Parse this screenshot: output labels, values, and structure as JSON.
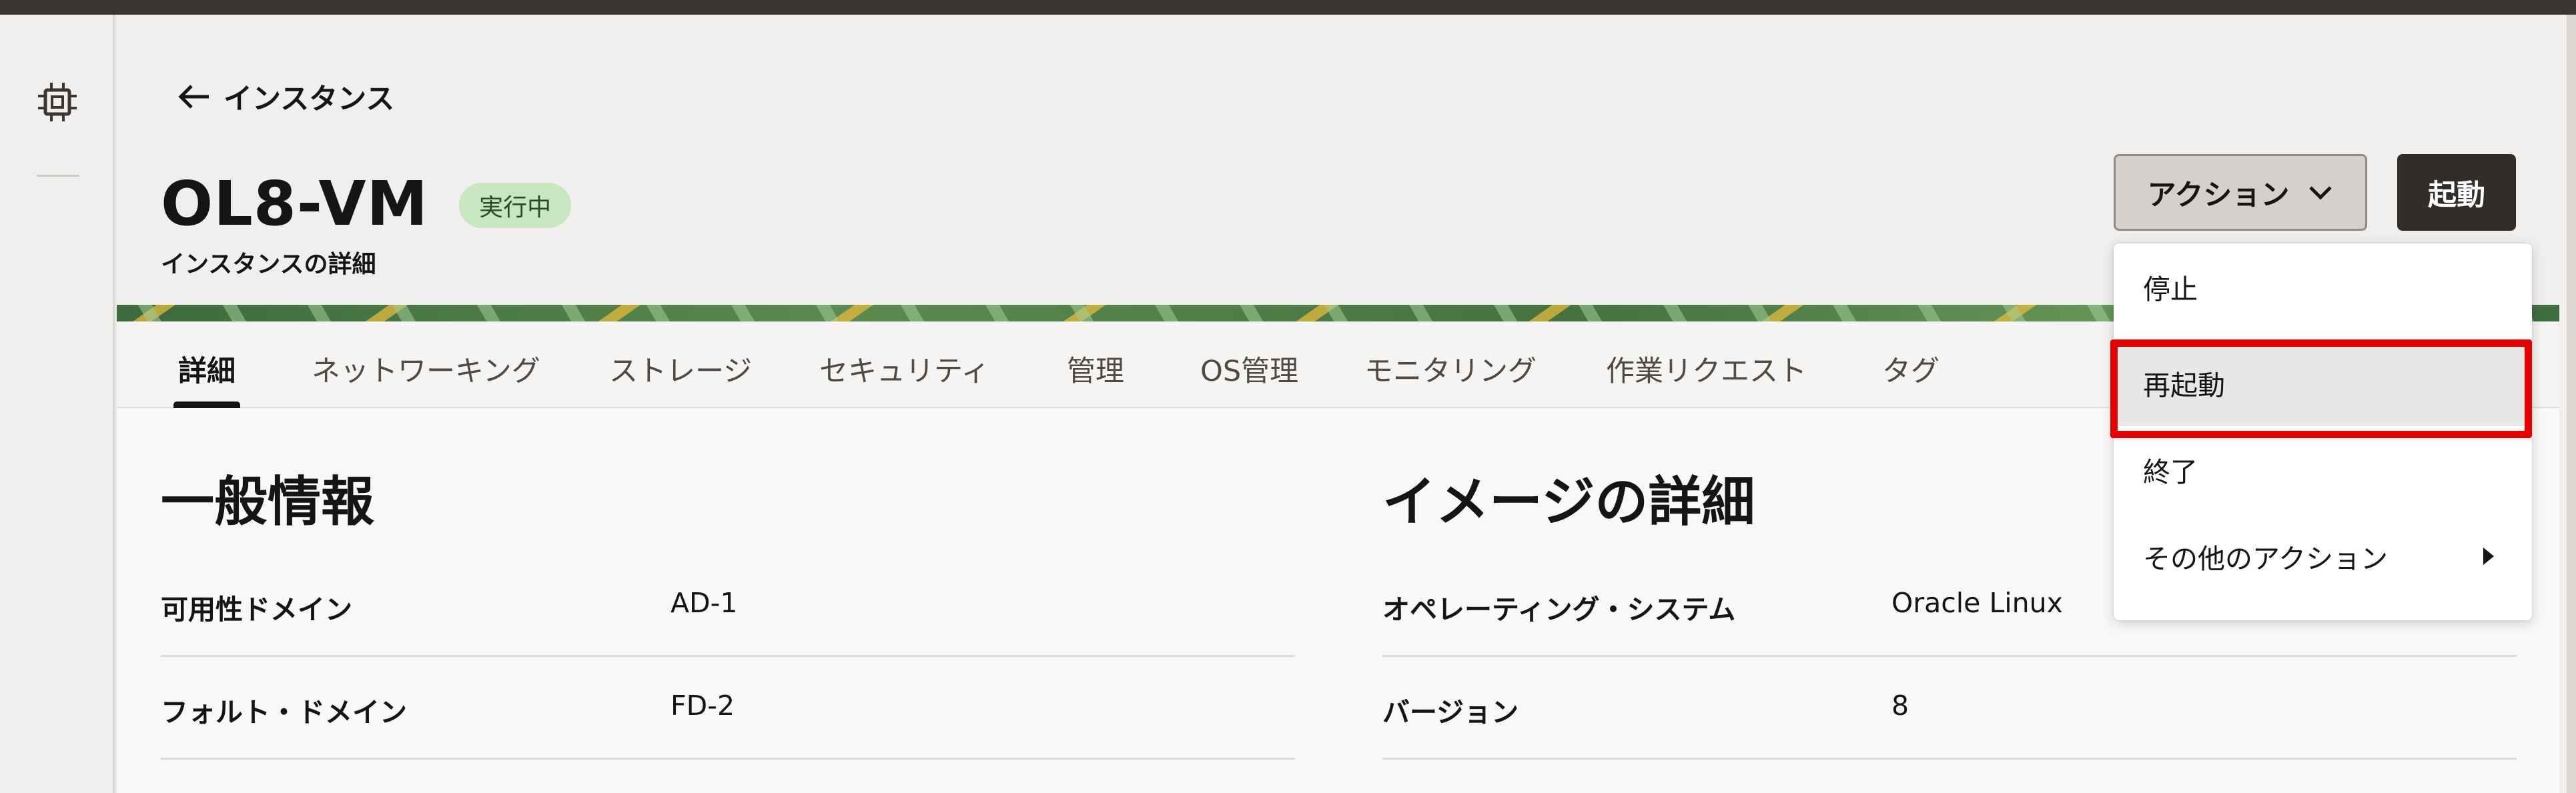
{
  "breadcrumb": {
    "back_label": "インスタンス"
  },
  "header": {
    "title": "OL8-VM",
    "status_badge": "実行中",
    "subtitle": "インスタンスの詳細",
    "actions_label": "アクション",
    "start_label": "起動"
  },
  "tabs": [
    {
      "label": "詳細",
      "active": true
    },
    {
      "label": "ネットワーキング"
    },
    {
      "label": "ストレージ"
    },
    {
      "label": "セキュリティ"
    },
    {
      "label": "管理"
    },
    {
      "label": "OS管理"
    },
    {
      "label": "モニタリング"
    },
    {
      "label": "作業リクエスト"
    },
    {
      "label": "タグ"
    }
  ],
  "general_info": {
    "title": "一般情報",
    "rows": [
      {
        "label": "可用性ドメイン",
        "value": "AD-1"
      },
      {
        "label": "フォルト・ドメイン",
        "value": "FD-2"
      }
    ]
  },
  "image_details": {
    "title": "イメージの詳細",
    "rows": [
      {
        "label": "オペレーティング・システム",
        "value": "Oracle Linux"
      },
      {
        "label": "バージョン",
        "value": "8"
      }
    ]
  },
  "actions_menu": {
    "items": [
      {
        "label": "停止"
      },
      {
        "label": "再起動",
        "highlighted": true
      },
      {
        "label": "終了"
      },
      {
        "label": "その他のアクション",
        "submenu": true
      }
    ]
  },
  "colors": {
    "accent_dark": "#312d2a",
    "badge_green": "#c8e6c0",
    "highlight_red": "#e60000"
  },
  "icons": {
    "rail": "chip-icon",
    "back": "arrow-left-icon",
    "actions": "chevron-down-icon",
    "submenu": "caret-right-icon"
  }
}
